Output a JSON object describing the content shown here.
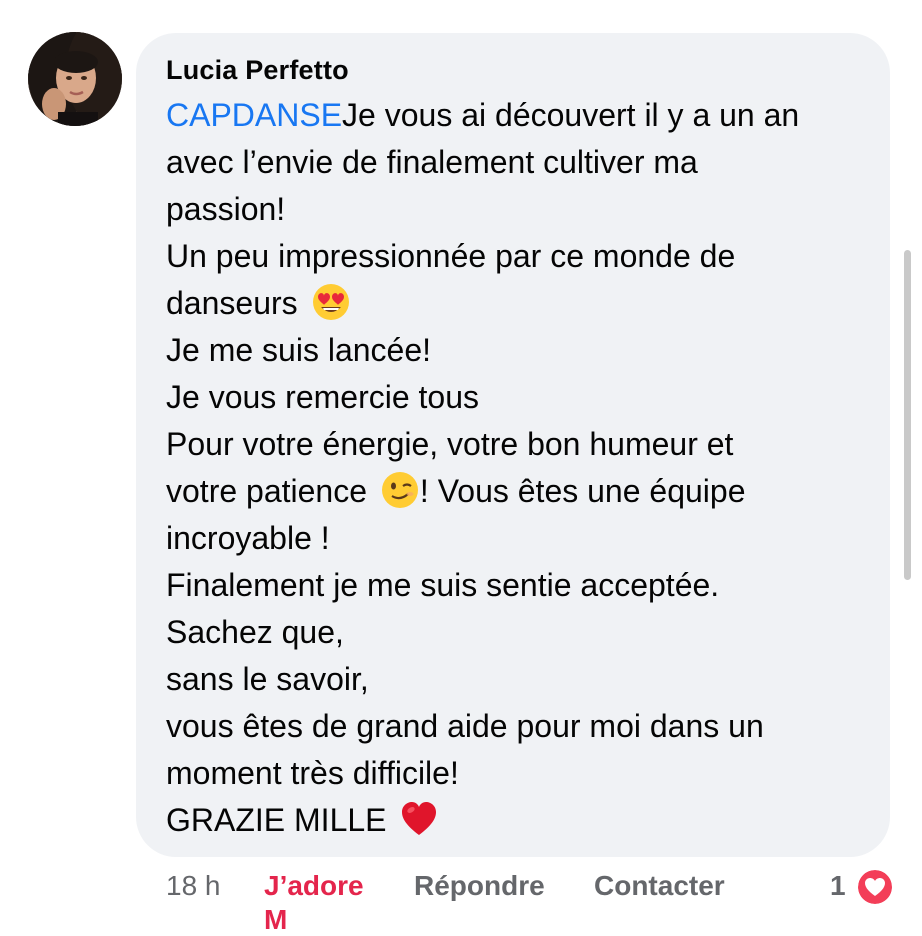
{
  "comment": {
    "author": "Lucia Perfetto",
    "mention": "CAPDANSE",
    "lines": [
      "Je vous ai découvert il y a un an",
      "avec l’envie de finalement cultiver ma",
      "passion!",
      "Un peu impressionnée par ce monde de",
      "danseurs",
      "Je me suis lancée!",
      "Je vous remercie tous",
      "Pour votre énergie, votre bon humeur et",
      "votre patience",
      "! Vous êtes une équipe",
      "incroyable !",
      "Finalement je me suis sentie acceptée.",
      "Sachez que,",
      "sans le savoir,",
      "vous êtes de grand aide pour moi dans un",
      "moment très difficile!",
      "GRAZIE MILLE"
    ],
    "emojis": {
      "line5": "heart-eyes-emoji",
      "line9": "winking-face-emoji",
      "line17": "red-heart-emoji"
    }
  },
  "actions": {
    "time": "18 h",
    "love_label": "J’adore",
    "reply_label": "Répondre",
    "contact_label": "Contacter",
    "reaction_count": "1"
  },
  "colors": {
    "bubble": "#f0f2f5",
    "mention": "#1877f2",
    "love": "#e4254c",
    "muted": "#65676b"
  }
}
